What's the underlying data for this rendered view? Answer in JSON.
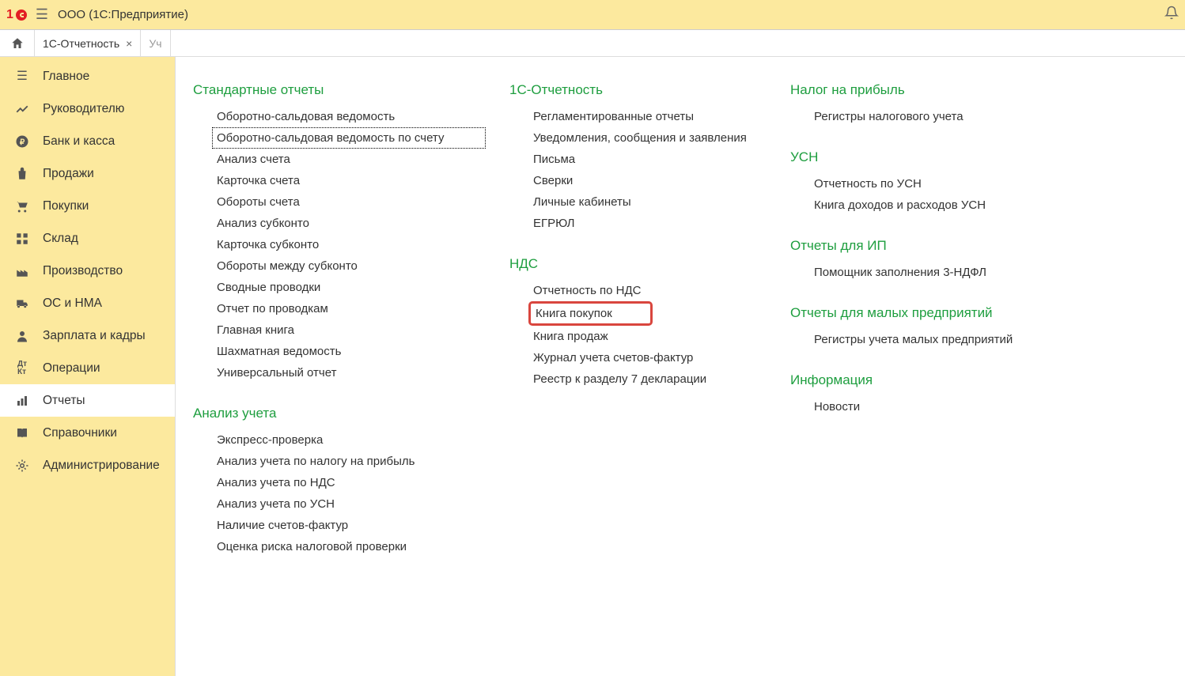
{
  "header": {
    "app_title": "ООО (1С:Предприятие)"
  },
  "tabs": {
    "active": "1С-Отчетность",
    "partial": "Уч"
  },
  "sidebar": {
    "items": [
      {
        "label": "Главное",
        "icon": "menu"
      },
      {
        "label": "Руководителю",
        "icon": "chart"
      },
      {
        "label": "Банк и касса",
        "icon": "ruble"
      },
      {
        "label": "Продажи",
        "icon": "bag"
      },
      {
        "label": "Покупки",
        "icon": "cart"
      },
      {
        "label": "Склад",
        "icon": "boxes"
      },
      {
        "label": "Производство",
        "icon": "factory"
      },
      {
        "label": "ОС и НМА",
        "icon": "truck"
      },
      {
        "label": "Зарплата и кадры",
        "icon": "person"
      },
      {
        "label": "Операции",
        "icon": "dtkt"
      },
      {
        "label": "Отчеты",
        "icon": "bars",
        "active": true
      },
      {
        "label": "Справочники",
        "icon": "book"
      },
      {
        "label": "Администрирование",
        "icon": "gear"
      }
    ]
  },
  "content": {
    "col1": {
      "sections": [
        {
          "title": "Стандартные отчеты",
          "items": [
            "Оборотно-сальдовая ведомость",
            "Оборотно-сальдовая ведомость по счету",
            "Анализ счета",
            "Карточка счета",
            "Обороты счета",
            "Анализ субконто",
            "Карточка субконто",
            "Обороты между субконто",
            "Сводные проводки",
            "Отчет по проводкам",
            "Главная книга",
            "Шахматная ведомость",
            "Универсальный отчет"
          ],
          "selected_index": 1
        },
        {
          "title": "Анализ учета",
          "items": [
            "Экспресс-проверка",
            "Анализ учета по налогу на прибыль",
            "Анализ учета по НДС",
            "Анализ учета по УСН",
            "Наличие счетов-фактур",
            "Оценка риска налоговой проверки"
          ]
        }
      ]
    },
    "col2": {
      "sections": [
        {
          "title": "1С-Отчетность",
          "items": [
            "Регламентированные отчеты",
            "Уведомления, сообщения и заявления",
            "Письма",
            "Сверки",
            "Личные кабинеты",
            "ЕГРЮЛ"
          ]
        },
        {
          "title": "НДС",
          "items": [
            "Отчетность по НДС",
            "Книга покупок",
            "Книга продаж",
            "Журнал учета счетов-фактур",
            "Реестр к разделу 7 декларации"
          ],
          "highlighted_index": 1
        }
      ]
    },
    "col3": {
      "sections": [
        {
          "title": "Налог на прибыль",
          "items": [
            "Регистры налогового учета"
          ]
        },
        {
          "title": "УСН",
          "items": [
            "Отчетность по УСН",
            "Книга доходов и расходов УСН"
          ]
        },
        {
          "title": "Отчеты для ИП",
          "items": [
            "Помощник заполнения 3-НДФЛ"
          ]
        },
        {
          "title": "Отчеты для малых предприятий",
          "items": [
            "Регистры учета малых предприятий"
          ]
        },
        {
          "title": "Информация",
          "items": [
            "Новости"
          ]
        }
      ]
    }
  }
}
